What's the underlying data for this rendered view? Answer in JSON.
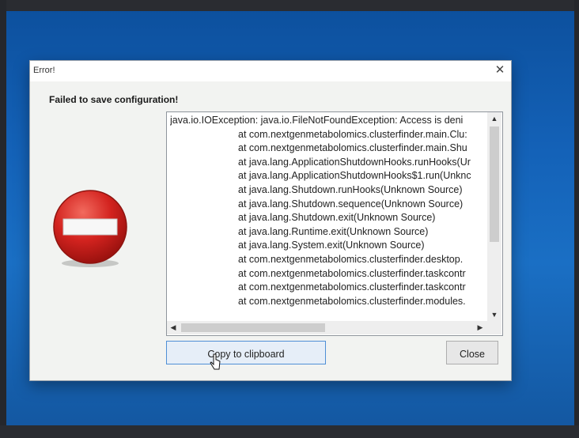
{
  "dialog": {
    "title": "Error!",
    "close_glyph": "✕",
    "headline": "Failed to save configuration!",
    "icon": "stop-error-icon",
    "stack_trace": [
      {
        "text": "java.io.IOException: java.io.FileNotFoundException: Access is deni",
        "indent": false
      },
      {
        "text": "at com.nextgenmetabolomics.clusterfinder.main.Clu:",
        "indent": true
      },
      {
        "text": "at com.nextgenmetabolomics.clusterfinder.main.Shu",
        "indent": true
      },
      {
        "text": "at java.lang.ApplicationShutdownHooks.runHooks(Ur",
        "indent": true
      },
      {
        "text": "at java.lang.ApplicationShutdownHooks$1.run(Unknc",
        "indent": true
      },
      {
        "text": "at java.lang.Shutdown.runHooks(Unknown Source)",
        "indent": true
      },
      {
        "text": "at java.lang.Shutdown.sequence(Unknown Source)",
        "indent": true
      },
      {
        "text": "at java.lang.Shutdown.exit(Unknown Source)",
        "indent": true
      },
      {
        "text": "at java.lang.Runtime.exit(Unknown Source)",
        "indent": true
      },
      {
        "text": "at java.lang.System.exit(Unknown Source)",
        "indent": true
      },
      {
        "text": "at com.nextgenmetabolomics.clusterfinder.desktop.",
        "indent": true
      },
      {
        "text": "at com.nextgenmetabolomics.clusterfinder.taskcontr",
        "indent": true
      },
      {
        "text": "at com.nextgenmetabolomics.clusterfinder.taskcontr",
        "indent": true
      },
      {
        "text": "at com.nextgenmetabolomics.clusterfinder.modules.",
        "indent": true
      }
    ],
    "scroll_glyphs": {
      "up": "▲",
      "down": "▼",
      "left": "◀",
      "right": "▶"
    },
    "buttons": {
      "copy": "Copy to clipboard",
      "close": "Close"
    }
  },
  "colors": {
    "desktop": "#1462b8",
    "error_red": "#d3231f",
    "dialog_bg": "#f2f3f1",
    "button_focus": "#4f8fd6"
  }
}
